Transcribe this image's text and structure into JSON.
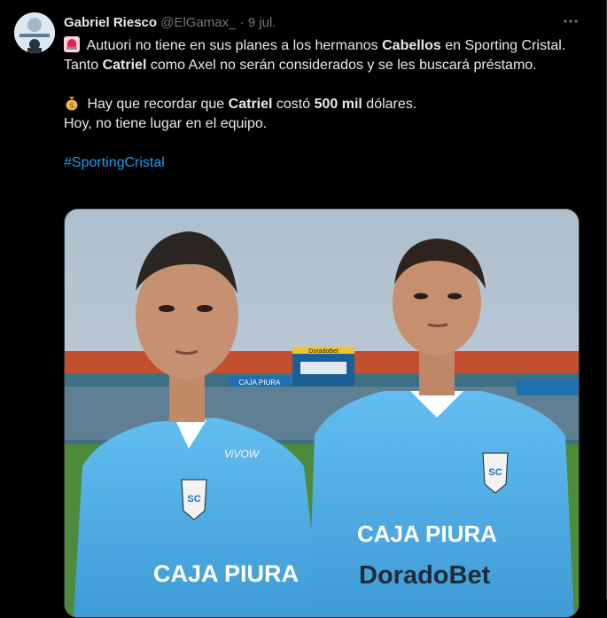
{
  "tweet": {
    "author_name": "Gabriel Riesco",
    "author_handle": "@ElGamax_",
    "separator": "·",
    "date": "9 jul.",
    "more_icon": "more-horizontal-icon",
    "line1_pre": " Autuori no tiene en sus planes a los hermanos ",
    "line1_bold": "Cabellos",
    "line1_post": " en Sporting Cristal.",
    "line2_pre": "Tanto ",
    "line2_bold": "Catriel",
    "line2_post": " como Axel no serán considerados y se les buscará préstamo.",
    "line3_pre": " Hay que recordar que ",
    "line3_bold1": "Catriel",
    "line3_mid": " costó ",
    "line3_bold2": "500 mil",
    "line3_post": " dólares.",
    "line4": "Hoy, no tiene lugar en el equipo.",
    "hashtag": "#SportingCristal",
    "emoji1": "police-light-icon",
    "emoji2": "money-bag-icon"
  },
  "media": {
    "scoreboard_brand": "DoradoBet",
    "banner_text": "CAJA PIURA",
    "shirt_sponsor_left": "CAJA PIURA",
    "shirt_sponsor_right": "CAJA PIURA",
    "shirt_bet_right": "DoradoBet",
    "crest_text": "SC",
    "shirt_brand_left": "ViVOW",
    "colors": {
      "sky": "#b9c8d4",
      "shirt": "#55b2e8",
      "grass": "#4c8b3b"
    }
  }
}
